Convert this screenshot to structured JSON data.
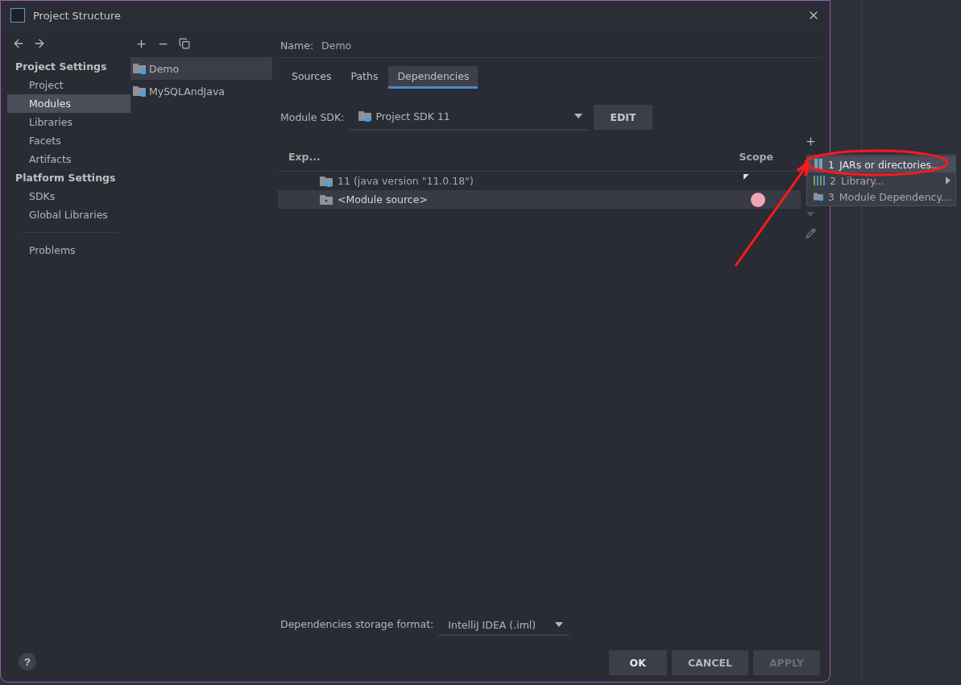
{
  "window": {
    "title": "Project Structure"
  },
  "sidebar": {
    "sections": [
      {
        "heading": "Project Settings",
        "items": [
          {
            "label": "Project",
            "selected": false
          },
          {
            "label": "Modules",
            "selected": true
          },
          {
            "label": "Libraries",
            "selected": false
          },
          {
            "label": "Facets",
            "selected": false
          },
          {
            "label": "Artifacts",
            "selected": false
          }
        ]
      },
      {
        "heading": "Platform Settings",
        "items": [
          {
            "label": "SDKs",
            "selected": false
          },
          {
            "label": "Global Libraries",
            "selected": false
          }
        ]
      }
    ],
    "footer_items": [
      {
        "label": "Problems",
        "selected": false
      }
    ],
    "help": "?"
  },
  "modules": [
    {
      "name": "Demo",
      "selected": true
    },
    {
      "name": "MySQLAndJava",
      "selected": false
    }
  ],
  "name_field": {
    "label": "Name:",
    "value": "Demo"
  },
  "tabs": [
    {
      "label": "Sources",
      "selected": false
    },
    {
      "label": "Paths",
      "selected": false
    },
    {
      "label": "Dependencies",
      "selected": true
    }
  ],
  "module_sdk": {
    "label": "Module SDK:",
    "value": "Project SDK 11",
    "button": "EDIT"
  },
  "dependencies": {
    "columns": [
      "Exp...",
      "Scope"
    ],
    "rows": [
      {
        "name": "11 (java version \"11.0.18\")",
        "kind": "sdk",
        "selected": false
      },
      {
        "name": "<Module source>",
        "kind": "source",
        "selected": true
      }
    ]
  },
  "add_menu": {
    "items": [
      {
        "number": "1",
        "label": "JARs or directories...",
        "kind": "jar",
        "selected": true,
        "submenu": false
      },
      {
        "number": "2",
        "label": "Library...",
        "kind": "library",
        "selected": false,
        "submenu": true
      },
      {
        "number": "3",
        "label": "Module Dependency...",
        "kind": "module",
        "selected": false,
        "submenu": false
      }
    ]
  },
  "storage_format": {
    "label": "Dependencies storage format:",
    "value": "IntelliJ IDEA (.iml)"
  },
  "buttons": [
    {
      "label": "OK",
      "kind": "default"
    },
    {
      "label": "CANCEL",
      "kind": "normal"
    },
    {
      "label": "APPLY",
      "kind": "disabled"
    }
  ]
}
